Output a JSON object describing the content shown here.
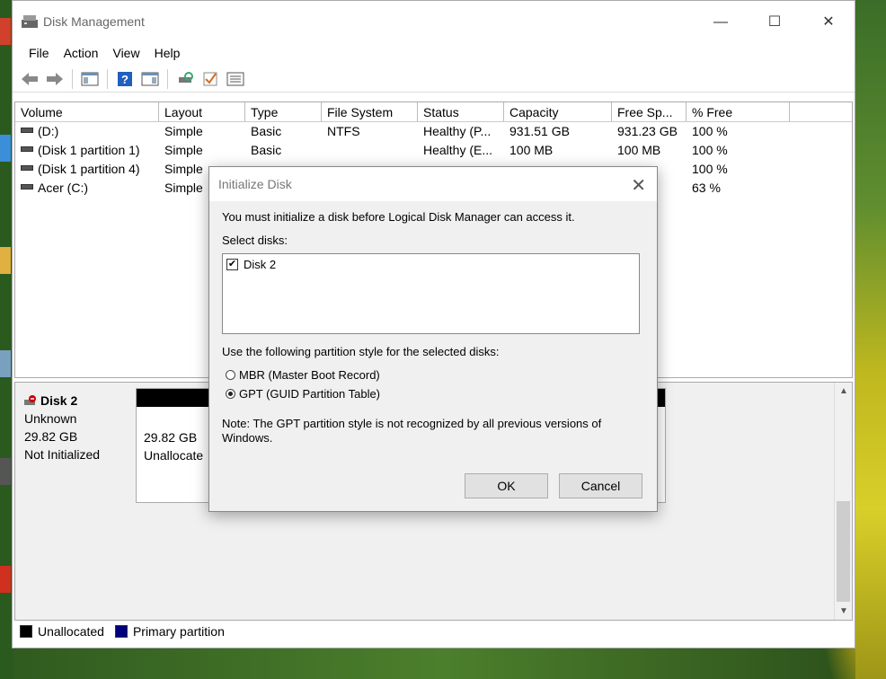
{
  "window": {
    "title": "Disk Management",
    "minimize": "—",
    "maximize": "☐",
    "close": "✕"
  },
  "menu": [
    "File",
    "Action",
    "View",
    "Help"
  ],
  "toolbar": [
    "back-icon",
    "forward-icon",
    "console-tree-icon",
    "help-icon",
    "properties-icon",
    "rescan-icon",
    "check-icon",
    "list-icon"
  ],
  "volumes": {
    "columns": [
      "Volume",
      "Layout",
      "Type",
      "File System",
      "Status",
      "Capacity",
      "Free Sp...",
      "% Free"
    ],
    "rows": [
      [
        "(D:)",
        "Simple",
        "Basic",
        "NTFS",
        "Healthy (P...",
        "931.51 GB",
        "931.23 GB",
        "100 %"
      ],
      [
        "(Disk 1 partition 1)",
        "Simple",
        "Basic",
        "",
        "Healthy (E...",
        "100 MB",
        "100 MB",
        "100 %"
      ],
      [
        "(Disk 1 partition 4)",
        "Simple",
        "",
        "",
        "",
        "",
        "",
        "100 %"
      ],
      [
        "Acer (C:)",
        "Simple",
        "",
        "",
        "",
        "",
        "GB",
        "63 %"
      ]
    ]
  },
  "disk": {
    "name": "Disk 2",
    "kind": "Unknown",
    "size": "29.82 GB",
    "state": "Not Initialized",
    "partition_size": "29.82 GB",
    "partition_label": "Unallocate"
  },
  "legend": {
    "unallocated": "Unallocated",
    "primary": "Primary partition",
    "unallocated_color": "#000000",
    "primary_color": "#00007f"
  },
  "dialog": {
    "title": "Initialize Disk",
    "close": "✕",
    "intro": "You must initialize a disk before Logical Disk Manager can access it.",
    "select_label": "Select disks:",
    "disks": [
      {
        "label": "Disk 2",
        "checked": true
      }
    ],
    "style_label": "Use the following partition style for the selected disks:",
    "mbr": "MBR (Master Boot Record)",
    "gpt": "GPT (GUID Partition Table)",
    "selected": "gpt",
    "note": "Note: The GPT partition style is not recognized by all previous versions of Windows.",
    "ok": "OK",
    "cancel": "Cancel"
  }
}
